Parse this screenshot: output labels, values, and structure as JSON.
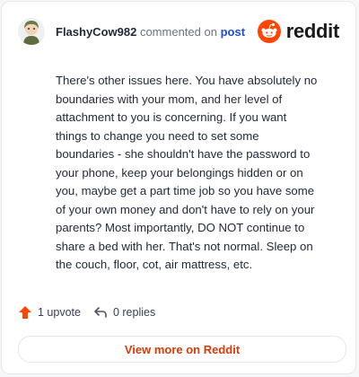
{
  "header": {
    "username": "FlashyCow982",
    "action_text": "commented on",
    "post_link": "post",
    "brand_text": "reddit"
  },
  "comment": {
    "lines": [
      "There's other issues here. You have absolutely no",
      "boundaries with your mom, and her level of",
      "attachment to you is concerning. If you want",
      "things to change you need to set some",
      "boundaries - she shouldn't have the password to",
      "your phone, keep your belongings hidden or on",
      "you, maybe get a part time job so you have some",
      "of your own money and don't have to rely on your",
      "parents? Most importantly, DO NOT continue to",
      "share a bed with her. That's not normal. Sleep on",
      "the couch, floor, cot, air mattress, etc."
    ]
  },
  "actions": {
    "upvote_label": "1 upvote",
    "replies_label": "0 replies"
  },
  "view_more": {
    "label": "View more on Reddit"
  },
  "icons": {
    "avatar": "avatar-icon",
    "brand": "reddit-logo-icon",
    "upvote": "upvote-arrow-icon",
    "replies": "reply-arrow-icon"
  },
  "colors": {
    "brand": "#ff4500",
    "link": "#1d4ed8",
    "view_more": "#d63b0b"
  }
}
